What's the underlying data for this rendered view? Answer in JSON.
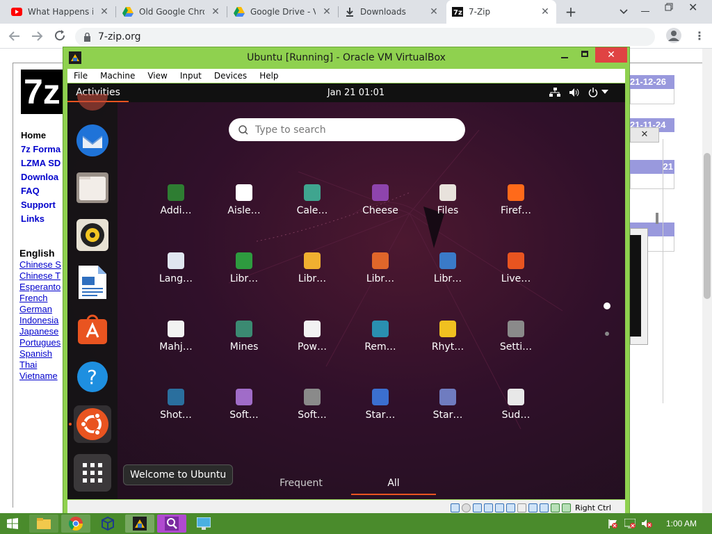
{
  "browser": {
    "tabs": [
      {
        "title": "What Happens if",
        "icon": "youtube-icon"
      },
      {
        "title": "Old Google Chro",
        "icon": "google-drive-icon"
      },
      {
        "title": "Google Drive - Vi",
        "icon": "google-drive-icon"
      },
      {
        "title": "Downloads",
        "icon": "download-icon"
      },
      {
        "title": "7-Zip",
        "icon": "7zip-icon"
      }
    ],
    "new_tab": "+",
    "url": "7-zip.org"
  },
  "site": {
    "logo": "7z",
    "nav": [
      "Home",
      "7z Forma",
      "LZMA SD",
      "Downloa",
      "FAQ",
      "Support",
      "Links"
    ],
    "lang_header": "English",
    "languages": [
      "Chinese S",
      "Chinese T",
      "Esperanto",
      "French",
      "German",
      "Indonesia",
      "Japanese",
      "Portugues",
      "Spanish",
      "Thai",
      "Vietname"
    ],
    "dates": [
      "21-12-26",
      "21-11-24",
      "21"
    ]
  },
  "vbox": {
    "title": "Ubuntu [Running] - Oracle VM VirtualBox",
    "menu": [
      "File",
      "Machine",
      "View",
      "Input",
      "Devices",
      "Help"
    ],
    "host_key": "Right Ctrl"
  },
  "ubuntu": {
    "activities": "Activities",
    "clock": "Jan 21  01:01",
    "search_placeholder": "Type to search",
    "tooltip": "Welcome to Ubuntu",
    "tabs": [
      "Frequent",
      "All"
    ],
    "apps": [
      {
        "label": "Addi…",
        "icon": "addons-icon",
        "color": "#2e7d32"
      },
      {
        "label": "Aisle…",
        "icon": "cards-icon",
        "color": "#ffffff"
      },
      {
        "label": "Cale…",
        "icon": "calendar-icon",
        "color": "#3fa58f"
      },
      {
        "label": "Cheese",
        "icon": "cheese-icon",
        "color": "#8e44ad"
      },
      {
        "label": "Files",
        "icon": "files-icon",
        "color": "#e8e2dc"
      },
      {
        "label": "Firef…",
        "icon": "firefox-icon",
        "color": "#ff6a1a"
      },
      {
        "label": "Lang…",
        "icon": "language-icon",
        "color": "#e0e6f0"
      },
      {
        "label": "Libr…",
        "icon": "libreoffice-calc-icon",
        "color": "#2e9b3f"
      },
      {
        "label": "Libr…",
        "icon": "libreoffice-draw-icon",
        "color": "#f0b030"
      },
      {
        "label": "Libr…",
        "icon": "libreoffice-impress-icon",
        "color": "#e0662a"
      },
      {
        "label": "Libr…",
        "icon": "libreoffice-writer-icon",
        "color": "#3a7ac8"
      },
      {
        "label": "Live…",
        "icon": "livepatch-icon",
        "color": "#e95420"
      },
      {
        "label": "Mahj…",
        "icon": "mahjongg-icon",
        "color": "#f2f2f2"
      },
      {
        "label": "Mines",
        "icon": "mines-icon",
        "color": "#3b8a72"
      },
      {
        "label": "Pow…",
        "icon": "power-stats-icon",
        "color": "#f2f2f2"
      },
      {
        "label": "Rem…",
        "icon": "remmina-icon",
        "color": "#2a8fb0"
      },
      {
        "label": "Rhyt…",
        "icon": "rhythmbox-icon",
        "color": "#f0c020"
      },
      {
        "label": "Setti…",
        "icon": "settings-icon",
        "color": "#8a8a8a"
      },
      {
        "label": "Shot…",
        "icon": "shotwell-icon",
        "color": "#2a6f9e"
      },
      {
        "label": "Soft…",
        "icon": "software-icon",
        "color": "#a06cc8"
      },
      {
        "label": "Soft…",
        "icon": "software-updater-icon",
        "color": "#8a8a8a"
      },
      {
        "label": "Star…",
        "icon": "startup-disk-icon",
        "color": "#3b6fd0"
      },
      {
        "label": "Star…",
        "icon": "startup-apps-icon",
        "color": "#6f7cc0"
      },
      {
        "label": "Sud…",
        "icon": "sudoku-icon",
        "color": "#e8e8e8"
      }
    ]
  },
  "taskbar": {
    "time": "1:00 AM"
  }
}
